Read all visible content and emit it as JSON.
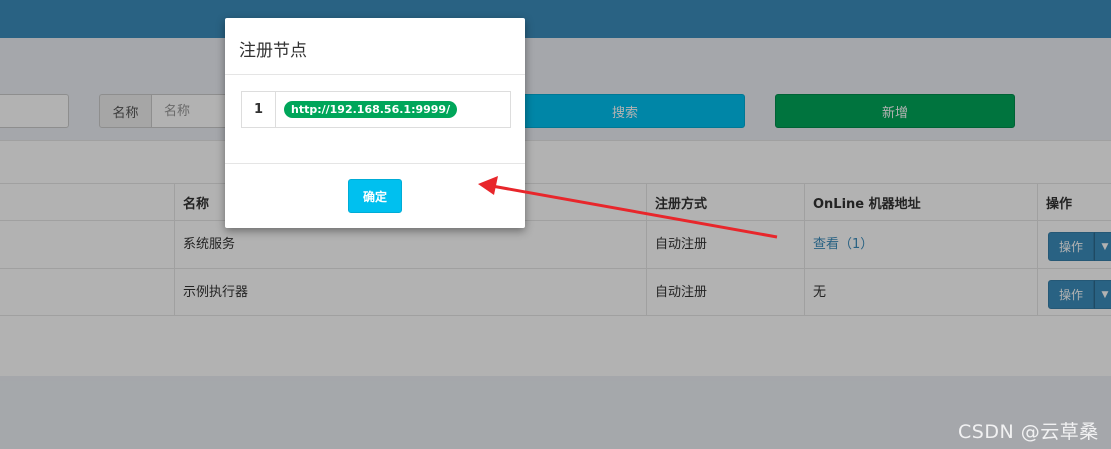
{
  "search": {
    "name_label": "名称",
    "name_placeholder": "名称",
    "search_button": "搜索",
    "add_button": "新增"
  },
  "table": {
    "headers": {
      "name": "名称",
      "type": "注册方式",
      "address": "OnLine 机器地址",
      "operation": "操作"
    },
    "rows": [
      {
        "name": "系统服务",
        "type": "自动注册",
        "address": "查看（1）",
        "operation": "操作"
      },
      {
        "name": "示例执行器",
        "type": "自动注册",
        "address": "无",
        "operation": "操作"
      }
    ]
  },
  "modal": {
    "title": "注册节点",
    "nodes": [
      {
        "index": "1",
        "url": "http://192.168.56.1:9999/"
      }
    ],
    "confirm_button": "确定"
  },
  "colors": {
    "header_bar": "#3c8dbc",
    "info": "#00c0ef",
    "success": "#00a65a",
    "primary": "#3c8dbc",
    "arrow": "#e8262b"
  },
  "watermark": "CSDN @云草桑"
}
